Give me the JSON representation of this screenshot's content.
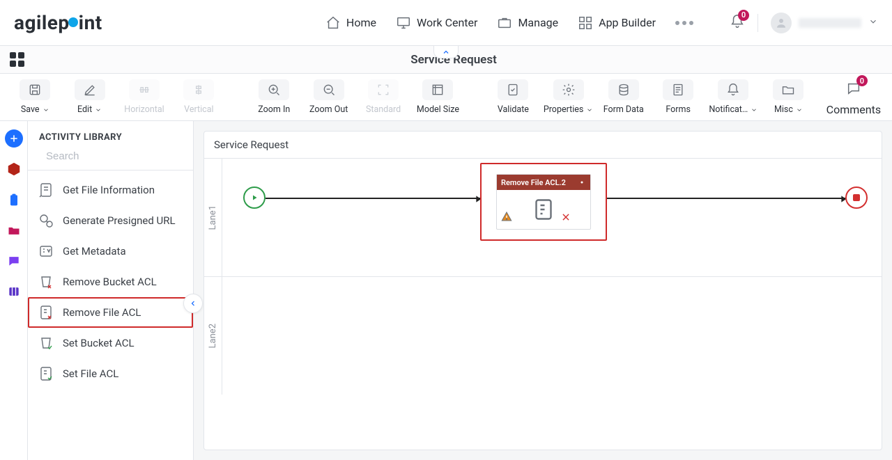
{
  "brand": {
    "text_before_dot": "agilep",
    "text_after_dot": "int"
  },
  "nav": {
    "home": "Home",
    "workcenter": "Work Center",
    "manage": "Manage",
    "appbuilder": "App Builder"
  },
  "notifications": {
    "count": "0"
  },
  "contextbar": {
    "title": "Service Request"
  },
  "toolbar": {
    "save": "Save",
    "edit": "Edit",
    "horizontal": "Horizontal",
    "vertical": "Vertical",
    "zoom_in": "Zoom In",
    "zoom_out": "Zoom Out",
    "standard": "Standard",
    "model_size": "Model Size",
    "validate": "Validate",
    "properties": "Properties",
    "form_data": "Form Data",
    "forms": "Forms",
    "notifications": "Notificat…",
    "misc": "Misc",
    "comments": "Comments",
    "comments_count": "0"
  },
  "panel": {
    "title": "ACTIVITY LIBRARY",
    "search_placeholder": "Search",
    "items": [
      {
        "label": "Get File Information"
      },
      {
        "label": "Generate Presigned URL"
      },
      {
        "label": "Get Metadata"
      },
      {
        "label": "Remove Bucket ACL"
      },
      {
        "label": "Remove File ACL",
        "selected": true
      },
      {
        "label": "Set Bucket ACL"
      },
      {
        "label": "Set File ACL"
      }
    ]
  },
  "canvas": {
    "title": "Service Request",
    "lanes": [
      {
        "name": "Lane1"
      },
      {
        "name": "Lane2"
      }
    ],
    "activity": {
      "title": "Remove File ACL.2"
    }
  }
}
